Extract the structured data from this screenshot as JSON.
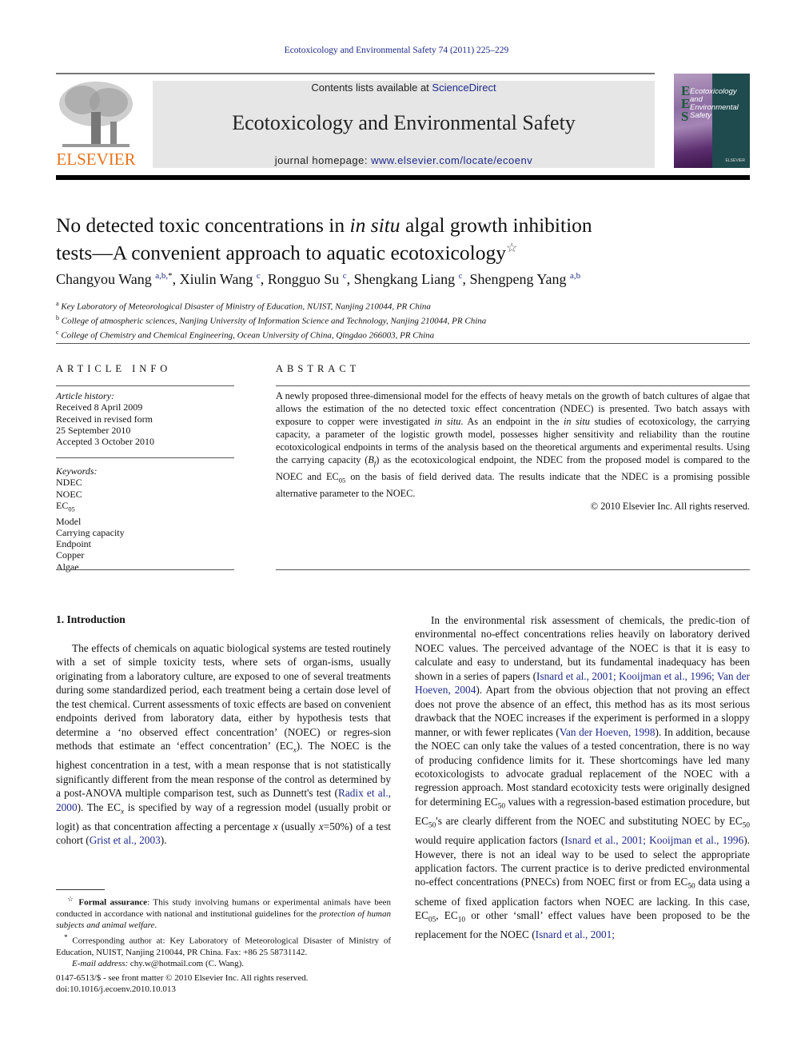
{
  "running_head": "Ecotoxicology and Environmental Safety 74 (2011) 225–229",
  "masthead": {
    "contents_prefix": "Contents lists available at ",
    "contents_link": "ScienceDirect",
    "journal_name": "Ecotoxicology and Environmental Safety",
    "homepage_prefix": "journal homepage: ",
    "homepage_link": "www.elsevier.com/locate/ecoenv",
    "publisher_logo": "ELSEVIER",
    "cover_letters": [
      "E",
      "E",
      "S"
    ],
    "cover_title": [
      "Ecotoxicology",
      "and",
      "Environmental",
      "Safety"
    ]
  },
  "article": {
    "title_line1_a": "No detected toxic concentrations in ",
    "title_line1_italic": "in situ",
    "title_line1_b": " algal growth inhibition",
    "title_line2": "tests—A convenient approach to aquatic ecotoxicology",
    "title_mark": "☆",
    "authors": [
      {
        "name": "Changyou Wang",
        "sup": "a,b,",
        "star": "*"
      },
      {
        "name": "Xiulin Wang",
        "sup": "c"
      },
      {
        "name": "Rongguo Su",
        "sup": "c"
      },
      {
        "name": "Shengkang Liang",
        "sup": "c"
      },
      {
        "name": "Shengpeng Yang",
        "sup": "a,b"
      }
    ],
    "affiliations": [
      {
        "mark": "a",
        "text": "Key Laboratory of Meteorological Disaster of Ministry of Education, NUIST, Nanjing 210044, PR China"
      },
      {
        "mark": "b",
        "text": "College of atmospheric sciences, Nanjing University of Information Science and Technology, Nanjing 210044, PR China"
      },
      {
        "mark": "c",
        "text": "College of Chemistry and Chemical Engineering, Ocean University of China, Qingdao 266003, PR China"
      }
    ]
  },
  "article_info": {
    "heading": "ARTICLE INFO",
    "history_label": "Article history:",
    "history": [
      "Received 8 April 2009",
      "Received in revised form",
      "25 September 2010",
      "Accepted 3 October 2010"
    ],
    "keywords_label": "Keywords:",
    "keywords": [
      "NDEC",
      "NOEC",
      "EC05",
      "Model",
      "Carrying capacity",
      "Endpoint",
      "Copper",
      "Algae"
    ]
  },
  "abstract": {
    "heading": "ABSTRACT",
    "p1": "A newly proposed three-dimensional model for the effects of heavy metals on the growth of batch cultures of algae that allows the estimation of the no detected toxic effect concentration (NDEC) is presented. Two batch assays with exposure to copper were investigated ",
    "p1_italic": "in situ",
    "p2": ". As an endpoint in the ",
    "p2_italic": "in situ",
    "p3": " studies of ecotoxicology, the carrying capacity, a parameter of the logistic growth model, possesses higher sensitivity and reliability than the routine ecotoxicological endpoints in terms of the analysis based on the theoretical arguments and experimental results. Using the carrying capacity (",
    "p3_var": "B",
    "p3_sub": "f",
    "p4": ") as the ecotoxicological endpoint, the NDEC from the proposed model is compared to the NOEC and EC",
    "p4_sub": "05",
    "p5": " on the basis of field derived data. The results indicate that the NDEC is a promising possible alternative parameter to the NOEC.",
    "copyright": "© 2010 Elsevier Inc. All rights reserved."
  },
  "intro": {
    "heading": "1.   Introduction",
    "left": {
      "s1": "The effects of chemicals on aquatic biological systems are tested routinely with a set of simple toxicity tests, where sets of organ-isms, usually originating from a laboratory culture, are exposed to one of several treatments during some standardized period, each treatment being a certain dose level of the test chemical. Current assessments of toxic effects are based on convenient endpoints derived from laboratory data, either by hypothesis tests that determine a ‘no observed effect concentration’ (NOEC) or regres-sion methods that estimate an ‘effect concentration’ (EC",
      "s1_sub": "x",
      "s2": "). The NOEC is the highest concentration in a test, with a mean response that is not statistically significantly different from the mean response of the control as determined by a post-ANOVA multiple comparison test, such as Dunnett's test (",
      "cite1": "Radix et al., 2000",
      "s3": "). The EC",
      "s3_sub": "x",
      "s4": " is specified by way of a regression model (usually probit or logit) as that concentration affecting a percentage ",
      "s4_var": "x",
      "s5": " (usually ",
      "s5_var": "x",
      "s6": "=50%) of a test cohort (",
      "cite2": "Grist et al., 2003",
      "s7": ")."
    },
    "right": {
      "s1": "In the environmental risk assessment of chemicals, the predic-tion of environmental no-effect concentrations relies heavily on laboratory derived NOEC values. The perceived advantage of the NOEC is that it is easy to calculate and easy to understand, but its fundamental inadequacy has been shown in a series of papers (",
      "cite1": "Isnard et al., 2001; Kooijman et al., 1996; Van der Hoeven, 2004",
      "s2": "). Apart from the obvious objection that not proving an effect does not prove the absence of an effect, this method has as its most serious drawback that the NOEC increases if the experiment is performed in a sloppy manner, or with fewer replicates (",
      "cite2": "Van der Hoeven, 1998",
      "s3": "). In addition, because the NOEC can only take the values of a tested concentration, there is no way of producing confidence limits for it. These shortcomings have led many ecotoxicologists to advocate gradual replacement of the NOEC with a regression approach. Most standard ecotoxicity tests were originally designed for determining EC",
      "sub50a": "50",
      "s4": " values with a regression-based estimation procedure, but EC",
      "sub50b": "50",
      "s5": "'s are clearly different from the NOEC and substituting NOEC by EC",
      "sub50c": "50",
      "s6": " would require application factors (",
      "cite3": "Isnard et al., 2001; Kooijman et al., 1996",
      "s7": "). However, there is not an ideal way to be used to select the appropriate application factors. The current practice is to derive predicted environmental no-effect concentrations (PNECs) from NOEC first or from EC",
      "sub50d": "50",
      "s8": " data using a scheme of fixed application factors when NOEC are lacking. In this case, EC",
      "sub05": "05",
      "s9": ", EC",
      "sub10": "10",
      "s10": " or other ‘small’ effect values have been proposed to be the replacement for the NOEC (",
      "cite4": "Isnard et al., 2001;"
    }
  },
  "footnotes": {
    "star_mark": "☆",
    "formal_label": "Formal assurance",
    "formal_text": ": This study involving humans or experimental animals have been conducted in accordance with national and institutional guidelines for the ",
    "formal_italic": "protection of human subjects and animal welfare",
    "formal_end": ".",
    "corr_mark": "*",
    "corr_text": " Corresponding author at: Key Laboratory of Meteorological Disaster of Ministry of Education, NUIST, Nanjing 210044, PR China. Fax: +86 25 58731142.",
    "email_label": "E-mail address:",
    "email": " chy.w@hotmail.com (C. Wang).",
    "front_matter": "0147-6513/$ - see front matter © 2010 Elsevier Inc. All rights reserved.",
    "doi": "doi:10.1016/j.ecoenv.2010.10.013"
  }
}
